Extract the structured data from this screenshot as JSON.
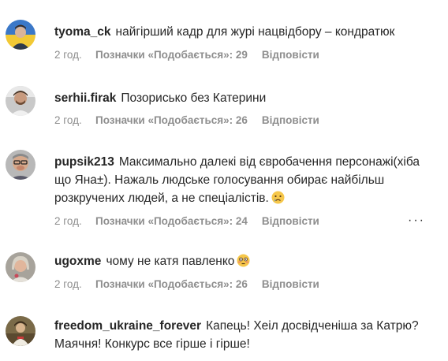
{
  "comments": [
    {
      "username": "tyoma_ck",
      "text": "найгірший кадр для журі нацвідбору – кондратюк",
      "time": "2 год.",
      "likes": "Позначки «Подобається»: 29",
      "reply": "Відповісти",
      "avatar": "avatar-ukraine-flag"
    },
    {
      "username": "serhii.firak",
      "text": "Позорисько без Катерини",
      "time": "2 год.",
      "likes": "Позначки «Подобається»: 26",
      "reply": "Відповісти",
      "avatar": "avatar-man-portrait"
    },
    {
      "username": "pupsik213",
      "text": "Максимально далекі від євробачення персонажі(хіба що Яна±). Нажаль людське голосування обирає найбільш розкручених людей, а не спеціалістів.",
      "emoji": "crying-face-emoji",
      "time": "2 год.",
      "likes": "Позначки «Подобається»: 24",
      "reply": "Відповісти",
      "more": "···",
      "avatar": "avatar-man-glasses"
    },
    {
      "username": "ugoxme",
      "text": "чому не катя павленко",
      "emoji": "flushed-face-emoji",
      "time": "2 год.",
      "likes": "Позначки «Подобається»: 26",
      "reply": "Відповісти",
      "avatar": "avatar-woman-portrait"
    },
    {
      "username": "freedom_ukraine_forever",
      "text": "Капець! Хеіл досвідченіша за Катрю? Маячня! Конкурс все гірше і гірше!",
      "avatar": "avatar-painting"
    }
  ],
  "colors": {
    "text": "#262626",
    "meta": "#8e8e8e"
  }
}
